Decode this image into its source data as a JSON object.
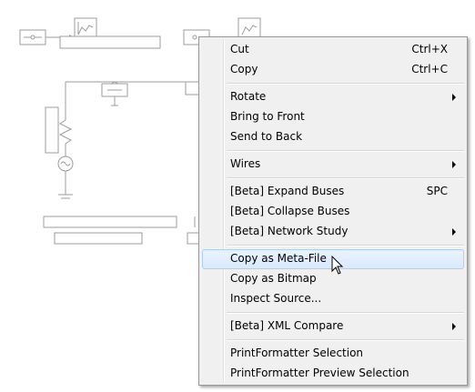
{
  "context_menu": {
    "groups": [
      [
        {
          "label": "Cut",
          "shortcut": "Ctrl+X",
          "submenu": false
        },
        {
          "label": "Copy",
          "shortcut": "Ctrl+C",
          "submenu": false
        }
      ],
      [
        {
          "label": "Rotate",
          "shortcut": "",
          "submenu": true
        },
        {
          "label": "Bring to Front",
          "shortcut": "",
          "submenu": false
        },
        {
          "label": "Send to Back",
          "shortcut": "",
          "submenu": false
        }
      ],
      [
        {
          "label": "Wires",
          "shortcut": "",
          "submenu": true
        }
      ],
      [
        {
          "label": "[Beta] Expand Buses",
          "shortcut": "SPC",
          "submenu": false
        },
        {
          "label": "[Beta] Collapse Buses",
          "shortcut": "",
          "submenu": false
        },
        {
          "label": "[Beta] Network Study",
          "shortcut": "",
          "submenu": true
        }
      ],
      [
        {
          "label": "Copy as Meta-File",
          "shortcut": "",
          "submenu": false,
          "highlighted": true
        },
        {
          "label": "Copy as Bitmap",
          "shortcut": "",
          "submenu": false
        },
        {
          "label": "Inspect Source...",
          "shortcut": "",
          "submenu": false
        }
      ],
      [
        {
          "label": "[Beta] XML Compare",
          "shortcut": "",
          "submenu": true
        }
      ],
      [
        {
          "label": "PrintFormatter Selection",
          "shortcut": "",
          "submenu": false
        },
        {
          "label": "PrintFormatter Preview Selection",
          "shortcut": "",
          "submenu": false
        }
      ]
    ]
  },
  "colors": {
    "menu_bg": "#f0f0f0",
    "highlight": "#d9e9fc",
    "canvas_lines": "#a0a0a0"
  },
  "cursor": {
    "icon": "arrow-pointer-icon"
  }
}
